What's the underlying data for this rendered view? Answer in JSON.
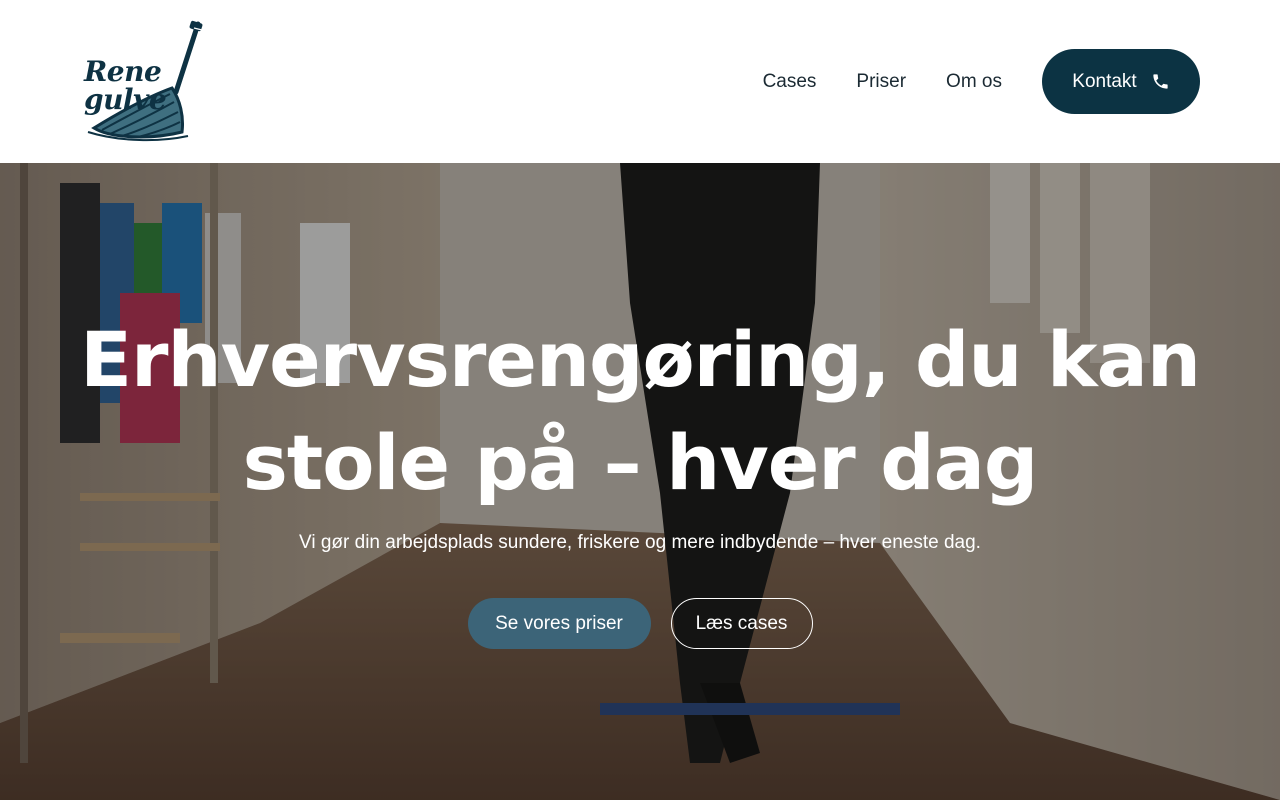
{
  "brand": {
    "logo_text": "Rene gulve",
    "primary_color": "#0c3343",
    "accent_color": "#3c6478"
  },
  "nav": {
    "items": [
      {
        "label": "Cases"
      },
      {
        "label": "Priser"
      },
      {
        "label": "Om os"
      }
    ],
    "contact_label": "Kontakt",
    "contact_icon": "phone-icon"
  },
  "hero": {
    "title_line1": "Erhvervsrengøring, du kan",
    "title_line2": "stole på – hver dag",
    "subtitle": "Vi gør din arbejdsplads sundere, friskere og mere indbydende – hver eneste dag.",
    "primary_cta": "Se vores priser",
    "secondary_cta": "Læs cases",
    "background_image": "cleaner mopping a school hallway with coat hooks and tiled floor"
  }
}
